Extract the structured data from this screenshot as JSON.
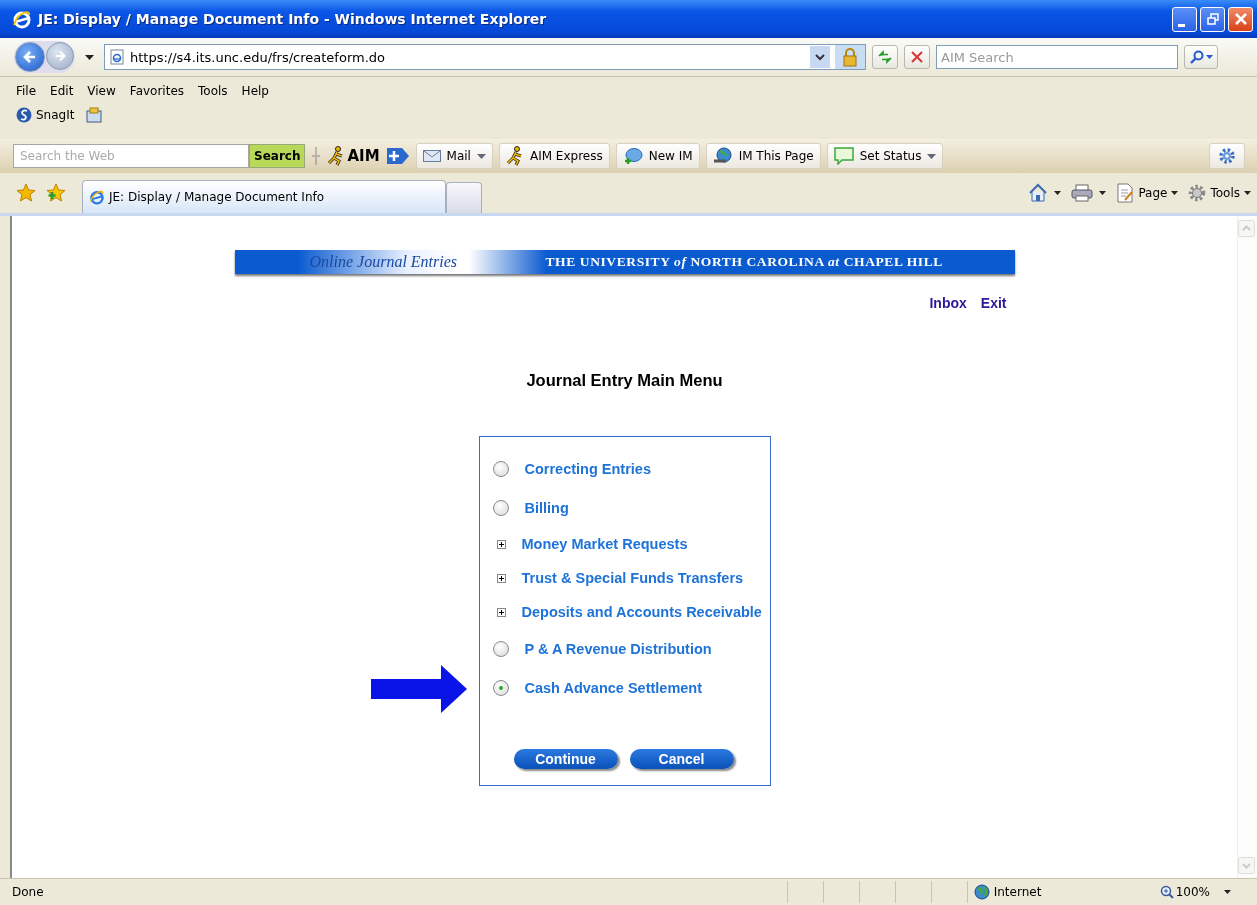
{
  "window": {
    "title": "JE: Display / Manage Document Info - Windows Internet Explorer"
  },
  "address_bar": {
    "url": "https://s4.its.unc.edu/frs/createform.do",
    "search_placeholder": "AIM Search"
  },
  "menu": [
    "File",
    "Edit",
    "View",
    "Favorites",
    "Tools",
    "Help"
  ],
  "links_bar": [
    "SnagIt"
  ],
  "aim_toolbar": {
    "search_placeholder": "Search the Web",
    "search_button": "Search",
    "brand": "AIM",
    "buttons": [
      {
        "label": "Mail",
        "dropdown": true,
        "kind": "mail"
      },
      {
        "label": "AIM Express",
        "dropdown": false,
        "kind": "runner"
      },
      {
        "label": "New IM",
        "dropdown": false,
        "kind": "bubble"
      },
      {
        "label": "IM This Page",
        "dropdown": false,
        "kind": "globe"
      },
      {
        "label": "Set Status",
        "dropdown": true,
        "kind": "note"
      }
    ]
  },
  "tabs": [
    {
      "label": "JE: Display / Manage Document Info",
      "selected": true
    }
  ],
  "command_bar": [
    "Page",
    "Tools"
  ],
  "page": {
    "banner": {
      "left": "Online Journal Entries",
      "right": "THE UNIVERSITY *of* NORTH CAROLINA *at* CHAPEL HILL"
    },
    "links": [
      "Inbox",
      "Exit"
    ],
    "heading": "Journal Entry Main Menu",
    "options": [
      {
        "kind": "radio",
        "label": "Correcting Entries",
        "selected": false
      },
      {
        "kind": "radio",
        "label": "Billing",
        "selected": false
      },
      {
        "kind": "expand",
        "label": "Money Market Requests",
        "expanded": false
      },
      {
        "kind": "expand",
        "label": "Trust & Special Funds Transfers",
        "expanded": false
      },
      {
        "kind": "expand",
        "label": "Deposits and Accounts Receivable",
        "expanded": false
      },
      {
        "kind": "radio",
        "label": "P & A Revenue Distribution",
        "selected": false
      },
      {
        "kind": "radio",
        "label": "Cash Advance Settlement",
        "selected": true
      }
    ],
    "buttons": [
      "Continue",
      "Cancel"
    ]
  },
  "status_bar": {
    "text": "Done",
    "zone": "Internet",
    "zoom": "100%"
  }
}
